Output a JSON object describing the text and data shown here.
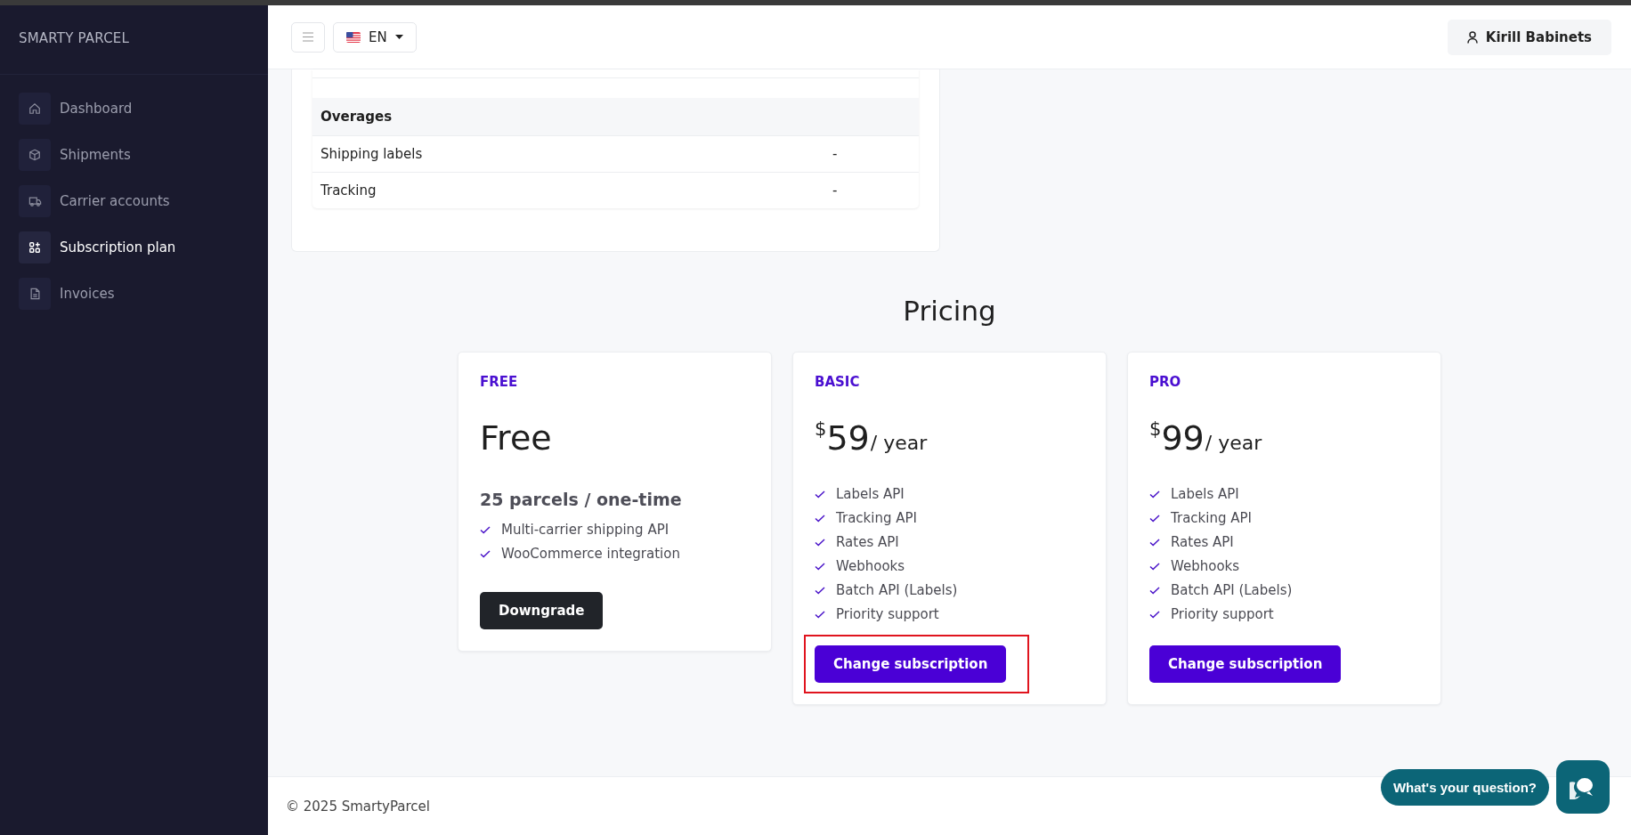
{
  "sidebar": {
    "brand": "SMARTY PARCEL",
    "items": [
      {
        "label": "Dashboard",
        "selected": false
      },
      {
        "label": "Shipments",
        "selected": false
      },
      {
        "label": "Carrier accounts",
        "selected": false
      },
      {
        "label": "Subscription plan",
        "selected": true
      },
      {
        "label": "Invoices",
        "selected": false
      }
    ]
  },
  "header": {
    "language": "EN",
    "user": "Kirill Babinets"
  },
  "usage_table": {
    "section": "Overages",
    "rows": [
      {
        "name": "Shipping labels",
        "value": "-"
      },
      {
        "name": "Tracking",
        "value": "-"
      }
    ]
  },
  "pricing": {
    "title": "Pricing",
    "plans": [
      {
        "tier": "FREE",
        "kind": "free",
        "price": "Free",
        "subtitle": "25 parcels / one-time",
        "features": [
          "Multi-carrier shipping API",
          "WooCommerce integration"
        ],
        "button": "Downgrade",
        "highlighted": false
      },
      {
        "tier": "BASIC",
        "kind": "paid",
        "currency": "$",
        "price": "59",
        "period": "/ year",
        "features": [
          "Labels API",
          "Tracking API",
          "Rates API",
          "Webhooks",
          "Batch API (Labels)",
          "Priority support"
        ],
        "button": "Change subscription",
        "highlighted": true
      },
      {
        "tier": "PRO",
        "kind": "paid",
        "currency": "$",
        "price": "99",
        "period": "/ year",
        "features": [
          "Labels API",
          "Tracking API",
          "Rates API",
          "Webhooks",
          "Batch API (Labels)",
          "Priority support"
        ],
        "button": "Change subscription",
        "highlighted": false
      }
    ]
  },
  "footer": {
    "copyright": "© 2025 SmartyParcel"
  },
  "chat": {
    "prompt": "What's your question?"
  }
}
